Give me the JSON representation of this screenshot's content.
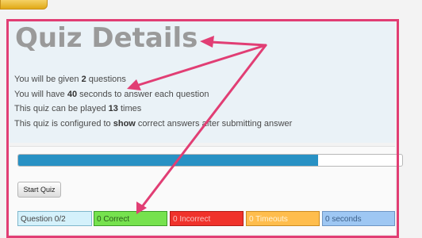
{
  "page": {
    "title": "Quiz Details"
  },
  "info": [
    {
      "before": "You will be given ",
      "value": "2",
      "after": " questions"
    },
    {
      "before": "You will have ",
      "value": "40",
      "after": " seconds to answer each question"
    },
    {
      "before": "This quiz can be played ",
      "value": "13",
      "after": " times"
    },
    {
      "before": "This quiz is configured to ",
      "value": "show",
      "after": " correct answers after submitting answer"
    }
  ],
  "progress": {
    "fraction": 0.78
  },
  "start_button": {
    "label": "Start Quiz"
  },
  "stats": [
    {
      "key": "question",
      "label": "Question 0/2",
      "bg": "#d4f1fb",
      "border": "#7fb7cc",
      "color": "#444444"
    },
    {
      "key": "correct",
      "label": "0 Correct",
      "bg": "#76e24e",
      "border": "#3c9c28",
      "color": "#2a5a1a"
    },
    {
      "key": "incorrect",
      "label": "0 Incorrect",
      "bg": "#f0322b",
      "border": "#b11c17",
      "color": "#f8c2c0"
    },
    {
      "key": "timeouts",
      "label": "0 Timeouts",
      "bg": "#ffbd4d",
      "border": "#cc8b22",
      "color": "#fff3d8"
    },
    {
      "key": "seconds",
      "label": "0 seconds",
      "bg": "#9ec7f3",
      "border": "#6d95c4",
      "color": "#3c5f88"
    }
  ],
  "colors": {
    "annotation": "#e13e74",
    "progress_fill": "#2891c4",
    "title_gray": "#9a9a9a"
  }
}
